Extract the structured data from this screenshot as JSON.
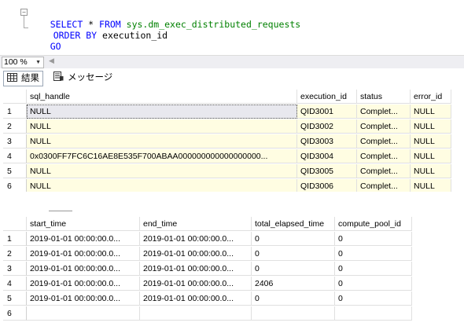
{
  "editor": {
    "collapse_symbol": "⊟",
    "line1": {
      "kw": "SELECT",
      "rest": " * ",
      "kw2": "FROM",
      "obj": " sys.dm_exec_distributed_requests"
    },
    "line2": {
      "kw": "ORDER BY",
      "rest": " execution_id"
    },
    "line3": {
      "kw": "GO"
    }
  },
  "zoom": {
    "value": "100 %",
    "arrow": "▼",
    "scroll_glyph": "◀"
  },
  "tabs": [
    {
      "label": "結果"
    },
    {
      "label": "メッセージ"
    }
  ],
  "grid1": {
    "columns": [
      "sql_handle",
      "execution_id",
      "status",
      "error_id"
    ],
    "rows": [
      {
        "num": "1",
        "cells": [
          "NULL",
          "QID3001",
          "Complet...",
          "NULL"
        ]
      },
      {
        "num": "2",
        "cells": [
          "NULL",
          "QID3002",
          "Complet...",
          "NULL"
        ]
      },
      {
        "num": "3",
        "cells": [
          "NULL",
          "QID3003",
          "Complet...",
          "NULL"
        ]
      },
      {
        "num": "4",
        "cells": [
          "0x0300FF7FC6C16AE8E535F700ABAA000000000000000000...",
          "QID3004",
          "Complet...",
          "NULL"
        ]
      },
      {
        "num": "5",
        "cells": [
          "NULL",
          "QID3005",
          "Complet...",
          "NULL"
        ]
      },
      {
        "num": "6",
        "cells": [
          "NULL",
          "QID3006",
          "Complet...",
          "NULL"
        ]
      }
    ]
  },
  "grid2": {
    "columns": [
      "start_time",
      "end_time",
      "total_elapsed_time",
      "compute_pool_id"
    ],
    "rows": [
      {
        "num": "1",
        "cells": [
          "2019-01-01 00:00:00.0...",
          "2019-01-01 00:00:00.0...",
          "0",
          "0"
        ]
      },
      {
        "num": "2",
        "cells": [
          "2019-01-01 00:00:00.0...",
          "2019-01-01 00:00:00.0...",
          "0",
          "0"
        ]
      },
      {
        "num": "3",
        "cells": [
          "2019-01-01 00:00:00.0...",
          "2019-01-01 00:00:00.0...",
          "0",
          "0"
        ]
      },
      {
        "num": "4",
        "cells": [
          "2019-01-01 00:00:00.0...",
          "2019-01-01 00:00:00.0...",
          "2406",
          "0"
        ]
      },
      {
        "num": "5",
        "cells": [
          "2019-01-01 00:00:00.0...",
          "2019-01-01 00:00:00.0...",
          "0",
          "0"
        ]
      },
      {
        "num": "6",
        "cells": [
          "",
          "",
          "",
          ""
        ]
      }
    ]
  }
}
